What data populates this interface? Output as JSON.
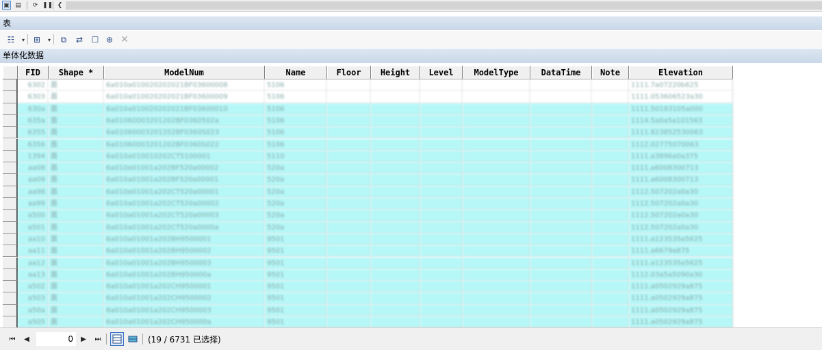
{
  "window_title": "表",
  "table_title": "单体化数据",
  "toolbar_icons": [
    "table-options-icon",
    "related-tables-icon",
    "select-by-attributes-icon",
    "switch-selection-icon",
    "clear-selection-icon",
    "zoom-to-selected-icon",
    "delete-selected-icon"
  ],
  "columns": [
    "FID",
    "Shape *",
    "ModelNum",
    "Name",
    "Floor",
    "Height",
    "Level",
    "ModelType",
    "DataTime",
    "Note",
    "Elevation"
  ],
  "rows": [
    {
      "FID": "6302",
      "Shape": "面",
      "ModelNum": "6a010a010020202021BF03600008",
      "Name": "5106",
      "Elevation": "1111.7a07220b625",
      "selected": false
    },
    {
      "FID": "6303",
      "Shape": "面",
      "ModelNum": "6a010a010020202021BF03600009",
      "Name": "5106",
      "Elevation": "1111.053606523a30",
      "selected": false
    },
    {
      "FID": "630a",
      "Shape": "面",
      "ModelNum": "6a010a010020202021BF03600010",
      "Name": "5106",
      "Elevation": "1111.50183105a000",
      "selected": true
    },
    {
      "FID": "635a",
      "Shape": "面",
      "ModelNum": "6a01060003201202BF0360502a",
      "Name": "5106",
      "Elevation": "1114.5a0a5a101563",
      "selected": true
    },
    {
      "FID": "6355",
      "Shape": "面",
      "ModelNum": "6a01060003201202BF0360S023",
      "Name": "5106",
      "Elevation": "1111.823852530063",
      "selected": true
    },
    {
      "FID": "6356",
      "Shape": "面",
      "ModelNum": "6a01060003201202BF0360S022",
      "Name": "5106",
      "Elevation": "1112.02775070063",
      "selected": true
    },
    {
      "FID": "1394",
      "Shape": "面",
      "ModelNum": "6a010a010010202CT5100001",
      "Name": "5110",
      "Elevation": "1111.a3896a0a375",
      "selected": true
    },
    {
      "FID": "aa08",
      "Shape": "面",
      "ModelNum": "6a010a01001a202BF520a00002",
      "Name": "520a",
      "Elevation": "1111.a6008300713",
      "selected": true
    },
    {
      "FID": "aa09",
      "Shape": "面",
      "ModelNum": "6a010a01001a202BF520a00001",
      "Name": "520a",
      "Elevation": "1111.a6008300713",
      "selected": true
    },
    {
      "FID": "aa98",
      "Shape": "面",
      "ModelNum": "6a010a01001a202CT520a00001",
      "Name": "520a",
      "Elevation": "1112.507202a0a30",
      "selected": true
    },
    {
      "FID": "aa99",
      "Shape": "面",
      "ModelNum": "6a010a01001a202CT520a00002",
      "Name": "520a",
      "Elevation": "1112.507202a0a30",
      "selected": true
    },
    {
      "FID": "a500",
      "Shape": "面",
      "ModelNum": "6a010a01001a202CT520a00003",
      "Name": "520a",
      "Elevation": "1112.507202a0a30",
      "selected": true
    },
    {
      "FID": "a501",
      "Shape": "面",
      "ModelNum": "6a010a01001a202CT520a0000a",
      "Name": "520a",
      "Elevation": "1112.507202a0a30",
      "selected": true
    },
    {
      "FID": "aa10",
      "Shape": "面",
      "ModelNum": "6a010a01001a202BH9500001",
      "Name": "9501",
      "Elevation": "1111.a123535a5625",
      "selected": true
    },
    {
      "FID": "aa11",
      "Shape": "面",
      "ModelNum": "6a010a01001a202BH9500002",
      "Name": "9501",
      "Elevation": "1111.a6679a875",
      "selected": true
    },
    {
      "FID": "aa12",
      "Shape": "面",
      "ModelNum": "6a010a01001a202BH9500003",
      "Name": "9501",
      "Elevation": "1111.a123535a5625",
      "selected": true
    },
    {
      "FID": "aa13",
      "Shape": "面",
      "ModelNum": "6a010a01001a202BH950000a",
      "Name": "9501",
      "Elevation": "1112.03a5a5090a30",
      "selected": true
    },
    {
      "FID": "a502",
      "Shape": "面",
      "ModelNum": "6a010a01001a202CH9500001",
      "Name": "9501",
      "Elevation": "1111.a0502929a875",
      "selected": true
    },
    {
      "FID": "a503",
      "Shape": "面",
      "ModelNum": "6a010a01001a202CH9500002",
      "Name": "9501",
      "Elevation": "1111.a0502929a875",
      "selected": true
    },
    {
      "FID": "a50a",
      "Shape": "面",
      "ModelNum": "6a010a01001a202CH9500003",
      "Name": "9501",
      "Elevation": "1111.a0502929a875",
      "selected": true
    },
    {
      "FID": "a505",
      "Shape": "面",
      "ModelNum": "6a010a01001a202CH950000a",
      "Name": "9501",
      "Elevation": "1111.a0502929a875",
      "selected": true
    }
  ],
  "footer": {
    "record_value": "0",
    "status": "(19 / 6731 已选择)"
  }
}
